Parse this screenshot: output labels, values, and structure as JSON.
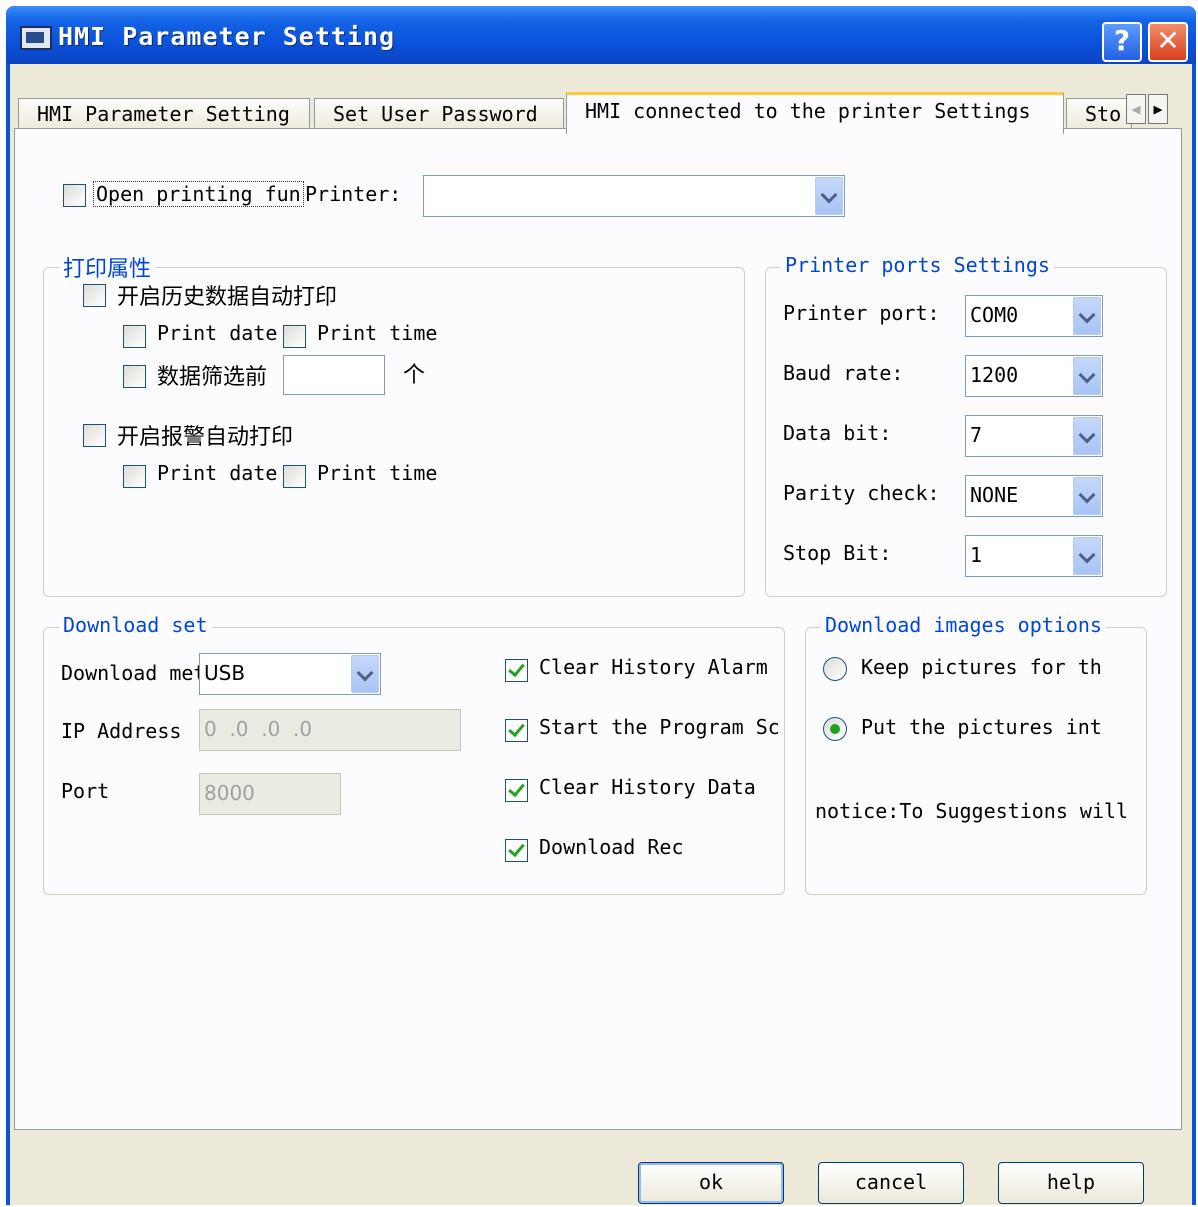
{
  "window": {
    "title": "HMI Parameter Setting",
    "help_glyph": "?",
    "close_glyph": "✕"
  },
  "tabs": [
    {
      "label": "HMI Parameter Setting"
    },
    {
      "label": "Set User Password"
    },
    {
      "label": "HMI connected to the printer Settings"
    },
    {
      "label": "Sto"
    }
  ],
  "tab_nav": {
    "left": "◀",
    "right": "▶"
  },
  "printing": {
    "open_label": "Open printing fun",
    "printer_label": "Printer:",
    "printer_value": ""
  },
  "print_props": {
    "legend": "打印属性",
    "history_auto": "开启历史数据自动打印",
    "print_date": "Print date",
    "print_time": "Print time",
    "filter_before": "数据筛选前",
    "filter_value": "",
    "unit": "个",
    "alarm_auto": "开启报警自动打印"
  },
  "ports": {
    "legend": "Printer ports Settings",
    "rows": [
      {
        "label": "Printer port:",
        "value": "COM0"
      },
      {
        "label": "Baud rate:",
        "value": "1200"
      },
      {
        "label": "Data bit:",
        "value": "7"
      },
      {
        "label": "Parity check:",
        "value": "NONE"
      },
      {
        "label": "Stop Bit:",
        "value": "1"
      }
    ]
  },
  "download": {
    "legend": "Download set",
    "method_label": "Download met",
    "method_value": "USB",
    "ip_label": "IP Address",
    "ip_value": "0  .0  .0  .0",
    "port_label": "Port",
    "port_value": "8000",
    "options": [
      {
        "label": "Clear History Alarm",
        "checked": true
      },
      {
        "label": "Start the Program Scr",
        "checked": true
      },
      {
        "label": "Clear History Data",
        "checked": true
      },
      {
        "label": "Download Rec",
        "checked": true
      }
    ]
  },
  "images": {
    "legend": "Download images options",
    "keep": "Keep pictures for th",
    "put": "Put the pictures int",
    "notice": "notice:To Suggestions will"
  },
  "buttons": {
    "ok": "ok",
    "cancel": "cancel",
    "help": "help"
  },
  "colors": {
    "title_bar": "#0a53d8",
    "group_legend": "#0046d5",
    "check": "#21a121",
    "tab_accent": "#ffc83c"
  }
}
